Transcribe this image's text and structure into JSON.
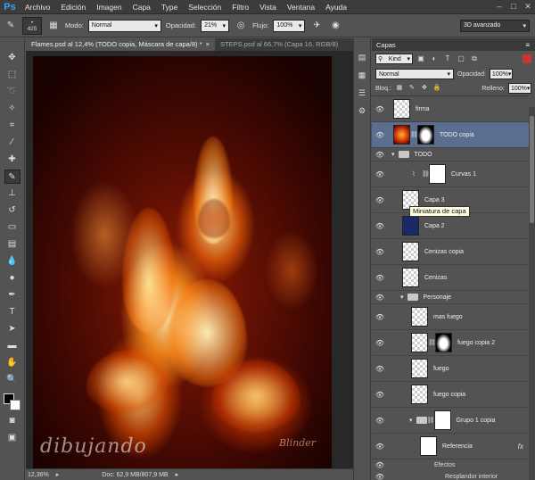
{
  "app_logo": "Ps",
  "menu": [
    "Archivo",
    "Edición",
    "Imagen",
    "Capa",
    "Type",
    "Selección",
    "Filtro",
    "Vista",
    "Ventana",
    "Ayuda"
  ],
  "window_controls": [
    "–",
    "□",
    "✕"
  ],
  "options": {
    "brush_size": "425",
    "mode_label": "Modo:",
    "mode_value": "Normal",
    "opacity_label": "Opacidad:",
    "opacity_value": "21%",
    "flow_label": "Flujo:",
    "flow_value": "100%",
    "workspace": "3D avanzado"
  },
  "tabs": [
    {
      "label": "Flames.psd al 12,4% (TODO copia, Máscara de capa/8) *",
      "close": "×",
      "active": true
    },
    {
      "label": "STEPS.psd al 66,7% (Capa 16, RGB/8)",
      "close": "",
      "active": false
    }
  ],
  "canvas": {
    "watermark": "dibujando",
    "art_signature": "Blinder"
  },
  "status": {
    "zoom": "12,36%",
    "doc": "Doc: 62,9 MB/807,9 MB"
  },
  "layers_panel": {
    "title": "Capas",
    "kind": "Kind",
    "blend_mode": "Normal",
    "opacity_label": "Opacidad:",
    "opacity_value": "100%",
    "lock_label": "Bloq.:",
    "fill_label": "Relleno:",
    "fill_value": "100%",
    "layers": [
      {
        "name": "firma",
        "thumb": "transparent"
      },
      {
        "name": "TODO copia",
        "thumb": "fire",
        "mask": true,
        "selected": true
      },
      {
        "name": "TODO",
        "group": true
      },
      {
        "name": "Curvas 1",
        "thumb": "adjust",
        "mask": true
      },
      {
        "name": "Capa 3",
        "thumb": "transparent"
      },
      {
        "name": "Capa 2",
        "thumb": "blue"
      },
      {
        "name": "Cenizas copia",
        "thumb": "transparent"
      },
      {
        "name": "Cenizas",
        "thumb": "transparent"
      },
      {
        "name": "Personaje",
        "group": true
      },
      {
        "name": "mas fuego",
        "thumb": "transparent"
      },
      {
        "name": "fuego copia 2",
        "thumb": "transparent",
        "mask": true
      },
      {
        "name": "fuego",
        "thumb": "transparent"
      },
      {
        "name": "fuego copia",
        "thumb": "transparent"
      },
      {
        "name": "Grupo 1 copia",
        "group_row": true
      },
      {
        "name": "Referencia",
        "thumb": "figure",
        "fx": "fx"
      }
    ],
    "effects_label": "Efectos",
    "effect": "Resplandor interior"
  },
  "tooltip": "Miniatura de capa"
}
